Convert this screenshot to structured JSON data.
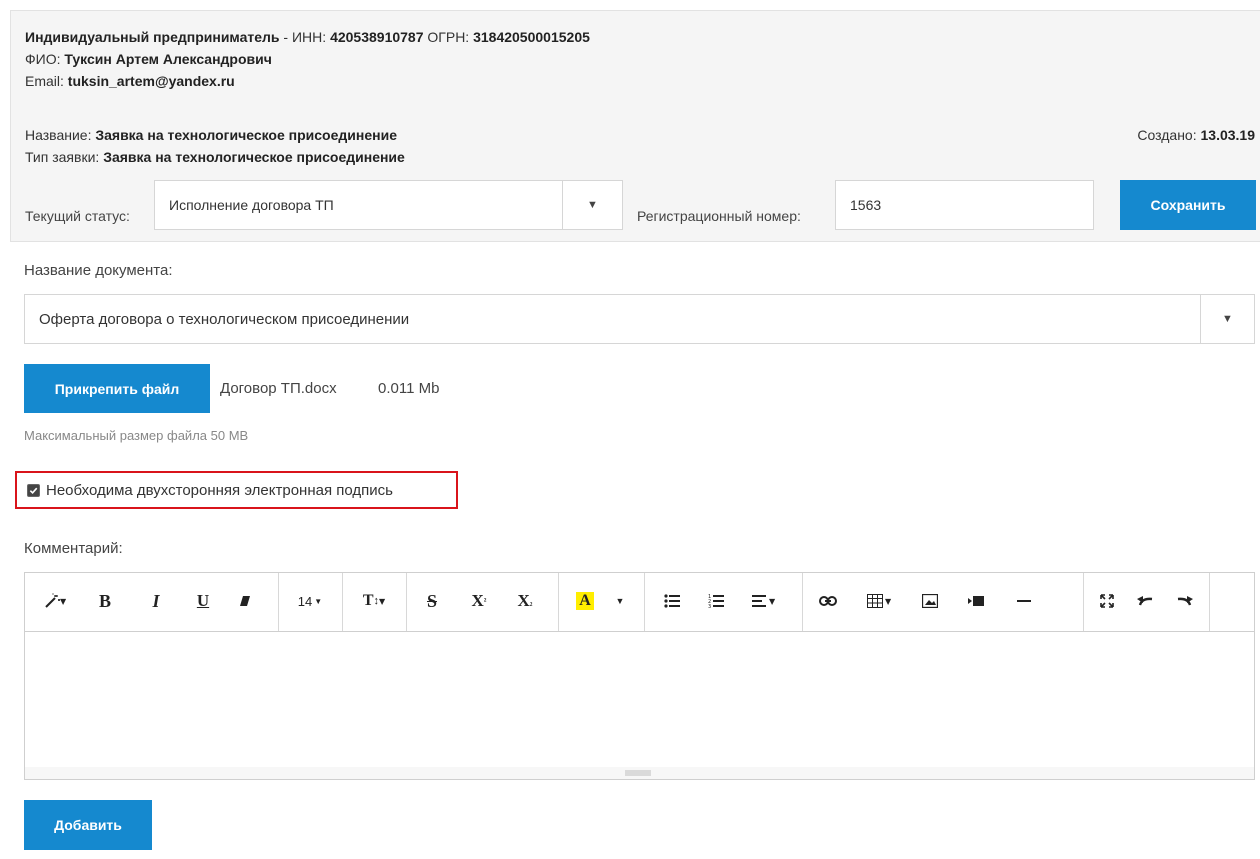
{
  "entity": {
    "type_label": "Индивидуальный предприниматель",
    "inn_sep": " - ИНН: ",
    "inn": "420538910787",
    "ogrn_label": " ОГРН: ",
    "ogrn": "318420500015205",
    "fio_label": "ФИО: ",
    "fio": "Туксин Артем Александрович",
    "email_label": "Email: ",
    "email": "tuksin_artem@yandex.ru"
  },
  "request": {
    "name_label": "Название: ",
    "name": "Заявка на технологическое присоединение",
    "type_label": "Тип заявки: ",
    "type": "Заявка на технологическое присоединение",
    "created_label": "Создано: ",
    "created": "13.03.19",
    "status_label": "Текущий статус:",
    "status_value": "Исполнение договора ТП",
    "regnum_label": "Регистрационный номер:",
    "regnum_value": "1563",
    "save_label": "Сохранить"
  },
  "document": {
    "name_label": "Название документа:",
    "name_value": "Оферта договора о технологическом присоединении",
    "attach_label": "Прикрепить файл",
    "file_name": "Договор ТП.docx",
    "file_size": "0.011 Mb",
    "max_size_hint": "Максимальный размер файла 50 MB",
    "signature_label": "Необходима двухсторонняя электронная подпись",
    "signature_checked": true
  },
  "comment": {
    "label": "Комментарий:",
    "font_size": "14",
    "add_label": "Добавить"
  },
  "colors": {
    "accent": "#1589cf",
    "highlight_box": "#d9141b"
  }
}
